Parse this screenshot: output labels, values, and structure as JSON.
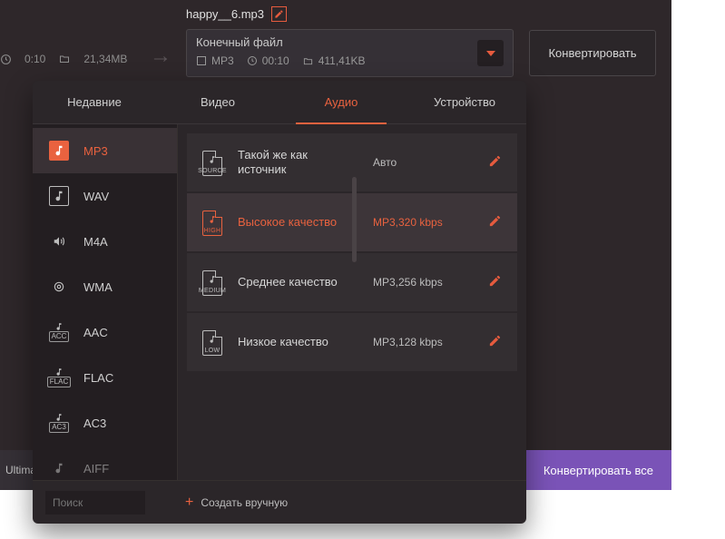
{
  "source": {
    "filename": "happy__6.mp3",
    "duration": "0:10",
    "size": "21,34MB"
  },
  "dest": {
    "title": "Конечный файл",
    "format": "MP3",
    "duration": "00:10",
    "size": "411,41KB"
  },
  "convert_label": "Конвертировать",
  "status_text": "Ultima",
  "convert_all_label": "Конвертировать все",
  "tabs": {
    "recent": "Недавние",
    "video": "Видео",
    "audio": "Аудио",
    "device": "Устройство"
  },
  "formats": [
    {
      "id": "mp3",
      "label": "MP3",
      "selected": true,
      "icon": "note-box"
    },
    {
      "id": "wav",
      "label": "WAV",
      "icon": "note-box"
    },
    {
      "id": "m4a",
      "label": "M4A",
      "icon": "speaker"
    },
    {
      "id": "wma",
      "label": "WMA",
      "icon": "swirl"
    },
    {
      "id": "aac",
      "label": "AAC",
      "icon": "badge",
      "badge": "ACC"
    },
    {
      "id": "flac",
      "label": "FLAC",
      "icon": "badge",
      "badge": "FLAC"
    },
    {
      "id": "ac3",
      "label": "AC3",
      "icon": "badge",
      "badge": "AC3"
    },
    {
      "id": "aiff",
      "label": "AIFF",
      "icon": "badge",
      "badge": ""
    }
  ],
  "qualities": [
    {
      "tag": "SOURCE",
      "name_l1": "Такой же как",
      "name_l2": "источник",
      "spec": "Авто",
      "active": false
    },
    {
      "tag": "HIGH",
      "name_l1": "Высокое качество",
      "name_l2": "",
      "spec": "MP3,320 kbps",
      "active": true
    },
    {
      "tag": "MEDIUM",
      "name_l1": "Среднее качество",
      "name_l2": "",
      "spec": "MP3,256 kbps",
      "active": false
    },
    {
      "tag": "LOW",
      "name_l1": "Низкое качество",
      "name_l2": "",
      "spec": "MP3,128 kbps",
      "active": false
    }
  ],
  "search_placeholder": "Поиск",
  "create_manual_label": "Создать вручную"
}
